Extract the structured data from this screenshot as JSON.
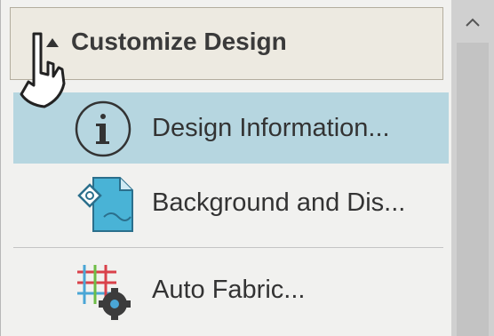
{
  "panel": {
    "header": {
      "label": "Customize Design",
      "expanded": true
    },
    "items": [
      {
        "label": "Design Information...",
        "icon": "info-icon",
        "selected": true
      },
      {
        "label": "Background and Dis...",
        "icon": "background-display-icon",
        "selected": false
      },
      {
        "label": "Auto Fabric...",
        "icon": "auto-fabric-icon",
        "selected": false
      }
    ]
  },
  "scrollbar": {
    "up_icon": "chevron-up-icon"
  },
  "colors": {
    "selected_bg": "#b6d6e0",
    "header_bg": "#edeae1",
    "panel_bg": "#f1f1ef"
  }
}
